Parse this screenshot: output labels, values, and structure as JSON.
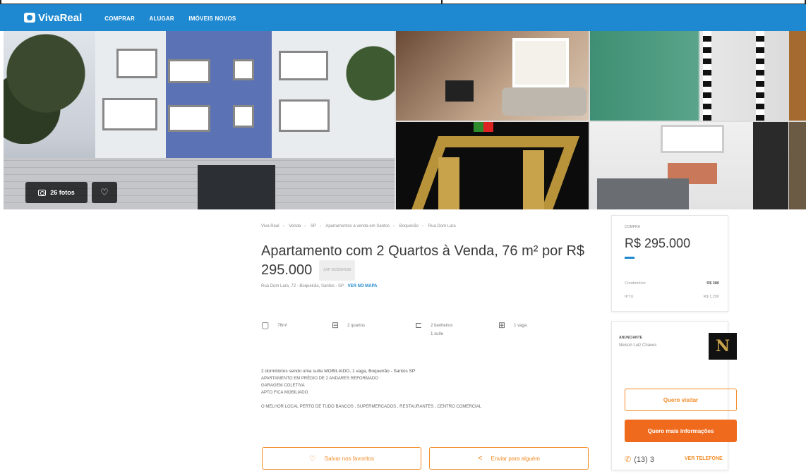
{
  "header": {
    "logo": "VivaReal",
    "nav": [
      "COMPRAR",
      "ALUGAR",
      "IMÓVEIS NOVOS"
    ]
  },
  "gallery": {
    "photos_label": "26 fotos",
    "favorite_icon": "heart-icon"
  },
  "breadcrumb": [
    "Viva Real",
    "Venda",
    "SP",
    "Apartamentos à venda em Santos",
    "Boqueirão",
    "Rua Dom Lara"
  ],
  "listing": {
    "title": "Apartamento com 2 Quartos à Venda, 76 m² por R$ 295.000",
    "code": "ZAP 2623284938",
    "address": "Rua Dom Lara, 72 - Boqueirão, Santos - SP",
    "map_link": "VER NO MAPA",
    "features": [
      {
        "icon": "area-icon",
        "label": "76m²",
        "sub": ""
      },
      {
        "icon": "bed-icon",
        "label": "2 quartos",
        "sub": ""
      },
      {
        "icon": "bath-icon",
        "label": "2 banheiros",
        "sub": "1 suíte"
      },
      {
        "icon": "car-icon",
        "label": "1 vaga",
        "sub": ""
      }
    ],
    "description": [
      "2 dormitórios sendo uma suíte MOBILIADO, 1 vaga, Boqueirão - Santos SP",
      "APARTAMENTO EM PRÉDIO DE 2 ANDARES REFORMADO",
      "GARAGEM COLETIVA",
      "APTO FICA MOBILIADO",
      "",
      "O MELHOR LOCAL PERTO DE TUDO BANCOS , SUPERMERCADOS , RESTAURANTES , CENTRO COMERCIAL"
    ],
    "save_button": "Salvar nos favoritos",
    "share_button": "Enviar para alguém"
  },
  "price_card": {
    "label": "COMPRA",
    "price": "R$ 295.000",
    "rows": [
      {
        "label": "Condomínio",
        "value": "R$ 380"
      },
      {
        "label": "IPTU",
        "value": "R$ 1.200"
      }
    ]
  },
  "agent_card": {
    "label": "ANUNCIANTE",
    "name": "Nelson Luiz Chaves",
    "visit_button": "Quero visitar",
    "info_button": "Quero mais informações",
    "phone": "(13) 3",
    "phone_link": "VER TELEFONE"
  },
  "colors": {
    "brand_blue": "#1e89d0",
    "accent_orange": "#f28c28",
    "cta_orange": "#f06a1d"
  }
}
